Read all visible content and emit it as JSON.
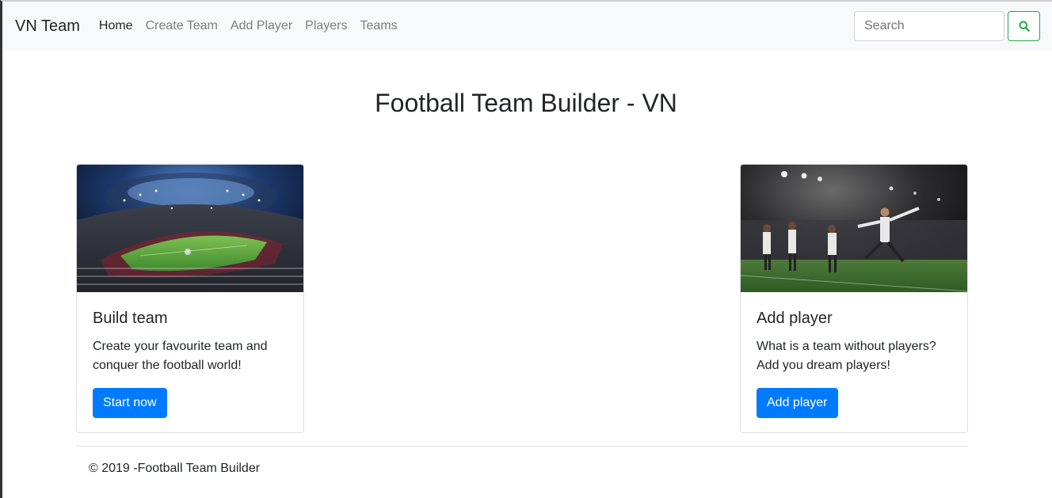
{
  "navbar": {
    "brand": "VN Team",
    "links": [
      {
        "label": "Home",
        "active": true
      },
      {
        "label": "Create Team",
        "active": false
      },
      {
        "label": "Add Player",
        "active": false
      },
      {
        "label": "Players",
        "active": false
      },
      {
        "label": "Teams",
        "active": false
      }
    ],
    "search": {
      "placeholder": "Search",
      "button_icon": "search-icon",
      "button_color": "#28a745"
    }
  },
  "main": {
    "title": "Football Team Builder - VN",
    "cards": [
      {
        "image": "stadium-photo",
        "title": "Build team",
        "text": "Create your favourite team and conquer the football world!",
        "button_label": "Start now"
      },
      {
        "image": "players-celebrating-photo",
        "title": "Add player",
        "text": "What is a team without players? Add you dream players!",
        "button_label": "Add player"
      }
    ]
  },
  "footer": {
    "text": "© 2019 -Football Team Builder"
  },
  "colors": {
    "primary": "#007bff",
    "success": "#28a745",
    "navbar_bg": "#f8f9fa"
  }
}
